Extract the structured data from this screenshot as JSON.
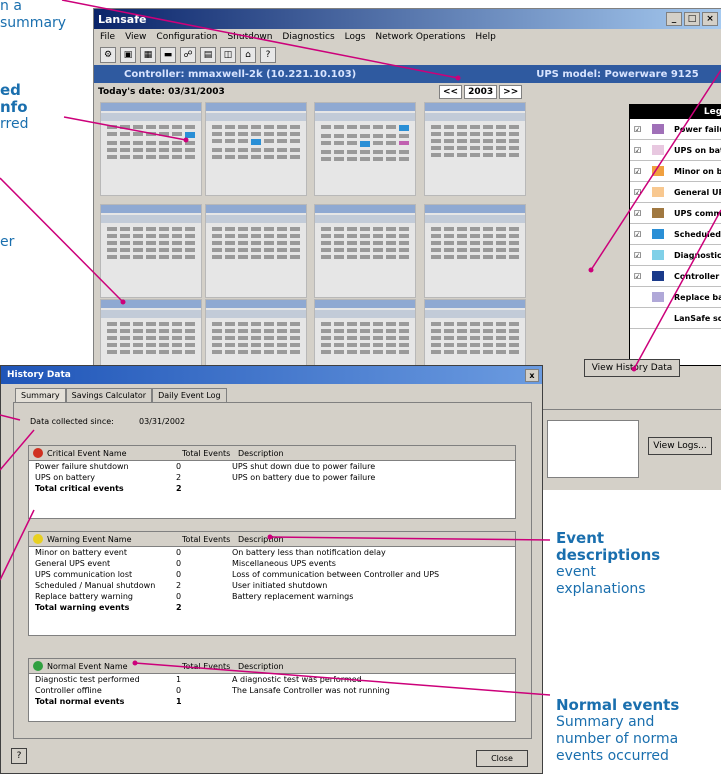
{
  "annotations": {
    "top_left_fragment": [
      "n a",
      "summary"
    ],
    "bold_fragment": [
      "ed",
      "nfo"
    ],
    "occurred_fragment": "rred",
    "er_fragment": "er",
    "event_descriptions": {
      "title_1": "Event",
      "title_2": "descriptions",
      "body_1": "event",
      "body_2": "explanations"
    },
    "normal_events": {
      "title": "Normal events",
      "body_1": "Summary and",
      "body_2": "number of norma",
      "body_3": "events occurred"
    }
  },
  "main_window": {
    "title": "Lansafe",
    "menu": [
      "File",
      "View",
      "Configuration",
      "Shutdown",
      "Diagnostics",
      "Logs",
      "Network Operations",
      "Help"
    ],
    "controller_label": "Controller: mmaxwell-2k (10.221.10.103)",
    "ups_model_label": "UPS model: Powerware 9125",
    "todays_date": "Today's date: 03/31/2003",
    "year": "2003",
    "year_prev": "<<",
    "year_next": ">>",
    "legend": {
      "title": "Legend",
      "items": [
        {
          "label": "Power failure shutdown",
          "color": "#a070b8",
          "checked": true
        },
        {
          "label": "UPS on battery",
          "color": "#e8c8e0",
          "checked": true
        },
        {
          "label": "Minor on battery event",
          "color": "#f0a040",
          "checked": true
        },
        {
          "label": "General UPS event",
          "color": "#f8c890",
          "checked": true
        },
        {
          "label": "UPS communication lost",
          "color": "#a07840",
          "checked": true
        },
        {
          "label": "Scheduled / Manual shutdown",
          "color": "#2a8fd6",
          "checked": true
        },
        {
          "label": "Diagnostic test performed",
          "color": "#80d0e8",
          "checked": true
        },
        {
          "label": "Controller offline",
          "color": "#1a3a8a",
          "checked": true
        },
        {
          "label": "Replace battery warning",
          "color": "#b0a8d8",
          "checked": false
        },
        {
          "label": "LanSafe software installed",
          "color": "#ffffff",
          "checked": false
        }
      ]
    },
    "view_history_button": "View History Data",
    "view_logs_button": "View Logs..."
  },
  "history_dialog": {
    "title": "History Data",
    "close_x": "x",
    "tabs": [
      "Summary",
      "Savings Calculator",
      "Daily Event Log"
    ],
    "data_collected_label": "Data collected since:",
    "data_collected_value": "03/31/2002",
    "critical": {
      "headers": [
        "Critical Event Name",
        "Total Events",
        "Description"
      ],
      "rows": [
        [
          "Power failure shutdown",
          "0",
          "UPS shut down due to power failure"
        ],
        [
          "UPS on battery",
          "2",
          "UPS on battery due to power failure"
        ]
      ],
      "total": [
        "Total critical events",
        "2"
      ]
    },
    "warning": {
      "headers": [
        "Warning Event Name",
        "Total Events",
        "Description"
      ],
      "rows": [
        [
          "Minor on battery event",
          "0",
          "On battery less than notification delay"
        ],
        [
          "General UPS event",
          "0",
          "Miscellaneous UPS events"
        ],
        [
          "UPS communication lost",
          "0",
          "Loss of communication between Controller and UPS"
        ],
        [
          "Scheduled / Manual shutdown",
          "2",
          "User initiated shutdown"
        ],
        [
          "Replace battery warning",
          "0",
          "Battery replacement warnings"
        ]
      ],
      "total": [
        "Total warning events",
        "2"
      ]
    },
    "normal": {
      "headers": [
        "Normal Event Name",
        "Total Events",
        "Description"
      ],
      "rows": [
        [
          "Diagnostic test performed",
          "1",
          "A diagnostic test was performed"
        ],
        [
          "Controller offline",
          "0",
          "The Lansafe Controller was not running"
        ]
      ],
      "total": [
        "Total normal events",
        "1"
      ]
    },
    "help_button": "?",
    "close_button": "Close"
  }
}
